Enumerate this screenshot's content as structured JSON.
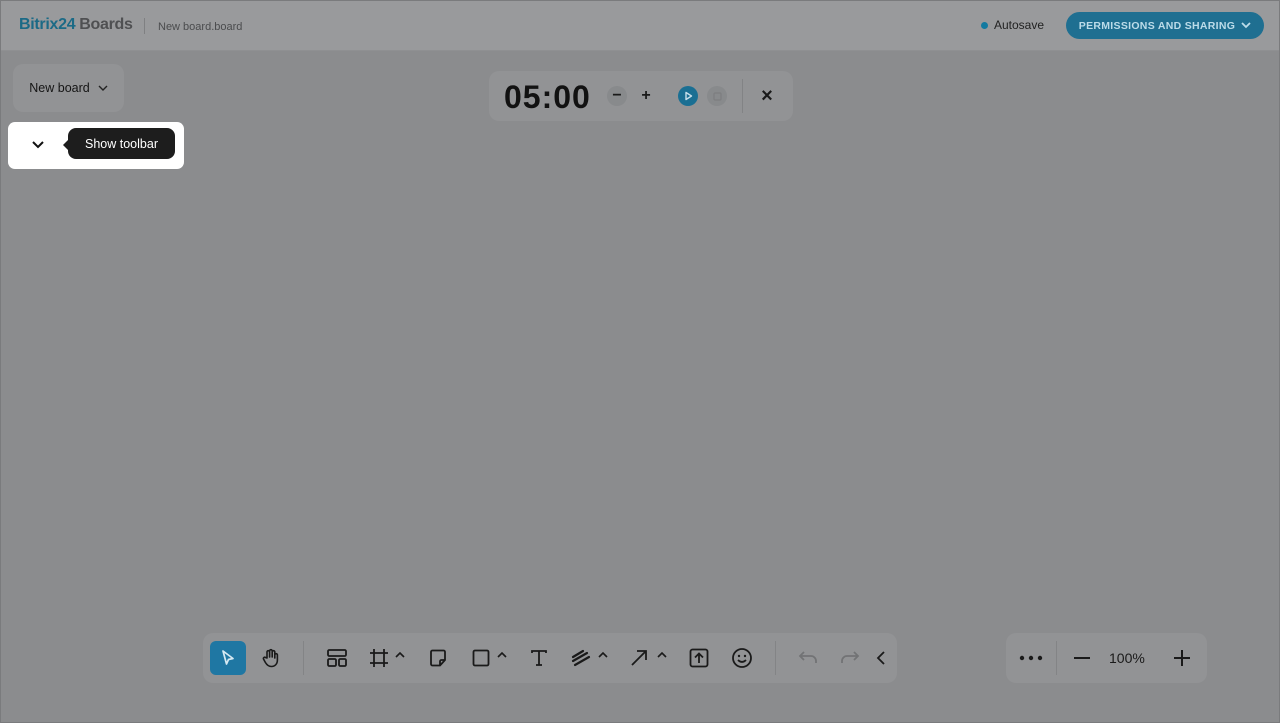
{
  "header": {
    "logo_brand": "Bitrix24",
    "logo_product": "Boards",
    "file_name": "New board.board",
    "autosave_label": "Autosave",
    "permissions_button": "PERMISSIONS AND SHARING"
  },
  "board_selector": {
    "label": "New board"
  },
  "tooltip": {
    "text": "Show toolbar"
  },
  "timer": {
    "minutes": "05",
    "separator": ":",
    "seconds": "00",
    "minus": "−",
    "plus": "+",
    "close": "×"
  },
  "toolbar": {
    "tools": [
      {
        "name": "select",
        "icon": "cursor-icon",
        "active": true
      },
      {
        "name": "hand",
        "icon": "hand-icon"
      },
      {
        "name": "templates",
        "icon": "templates-icon"
      },
      {
        "name": "frame",
        "icon": "frame-icon",
        "has_menu": true
      },
      {
        "name": "sticky-note",
        "icon": "sticky-note-icon"
      },
      {
        "name": "shape",
        "icon": "rectangle-icon",
        "has_menu": true
      },
      {
        "name": "text",
        "icon": "text-icon"
      },
      {
        "name": "pen",
        "icon": "pen-icon",
        "has_menu": true
      },
      {
        "name": "arrow",
        "icon": "arrow-icon",
        "has_menu": true
      },
      {
        "name": "upload",
        "icon": "upload-icon"
      },
      {
        "name": "emoji",
        "icon": "emoji-icon"
      },
      {
        "name": "undo",
        "icon": "undo-icon"
      },
      {
        "name": "redo",
        "icon": "redo-icon"
      },
      {
        "name": "collapse",
        "icon": "chevron-left-icon"
      }
    ]
  },
  "zoom": {
    "value": "100%"
  },
  "colors": {
    "accent": "#1f77a3",
    "overlay": "#8b8c8e"
  }
}
